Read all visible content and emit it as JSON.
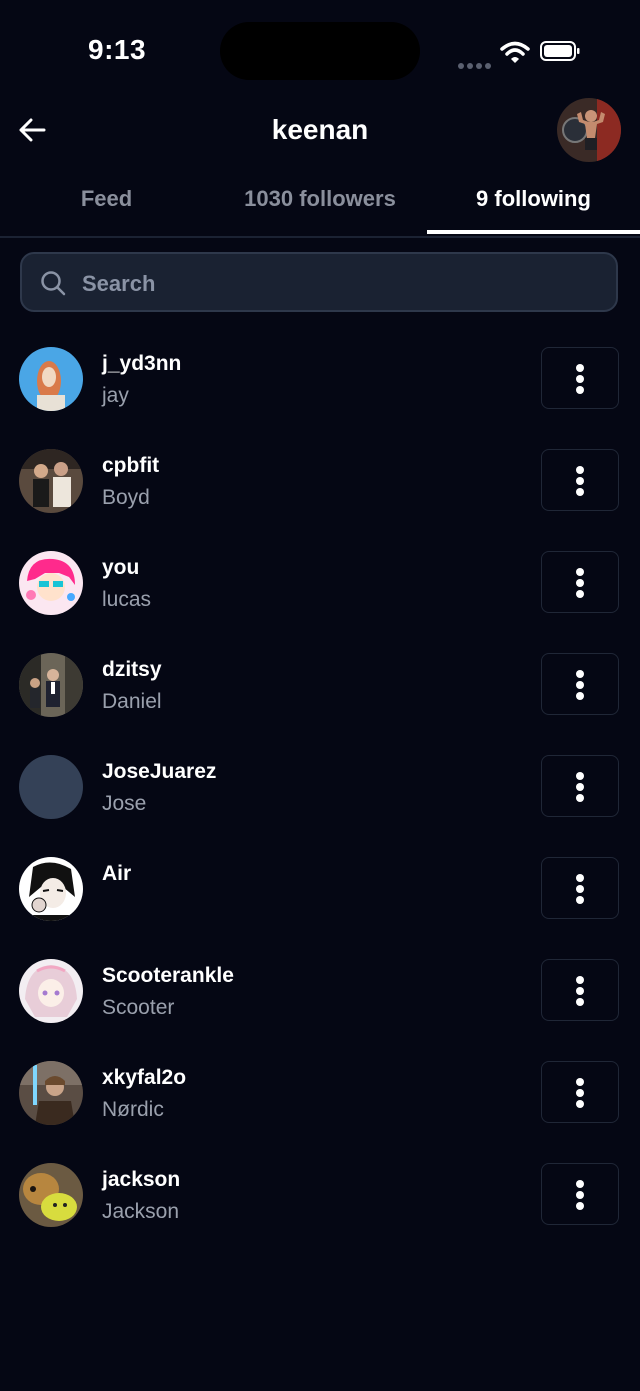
{
  "status": {
    "time": "9:13"
  },
  "header": {
    "title": "keenan"
  },
  "tabs": [
    {
      "label": "Feed"
    },
    {
      "label": "1030 followers"
    },
    {
      "label": "9 following"
    }
  ],
  "active_tab": "9 following",
  "search": {
    "placeholder": "Search",
    "value": ""
  },
  "following": [
    {
      "username": "j_yd3nn",
      "display_name": "jay"
    },
    {
      "username": "cpbfit",
      "display_name": "Boyd"
    },
    {
      "username": "you",
      "display_name": "lucas"
    },
    {
      "username": "dzitsy",
      "display_name": "Daniel"
    },
    {
      "username": "JoseJuarez",
      "display_name": "Jose"
    },
    {
      "username": "Air",
      "display_name": ""
    },
    {
      "username": "Scooterankle",
      "display_name": "Scooter"
    },
    {
      "username": "xkyfal2o",
      "display_name": "Nørdic"
    },
    {
      "username": "jackson",
      "display_name": "Jackson"
    }
  ],
  "colors": {
    "background": "#050714",
    "search_bg": "#1a2232",
    "secondary_text": "#9aa0ad",
    "placeholder_avatar": "#344157"
  },
  "icons": [
    "back-arrow-icon",
    "search-icon",
    "more-vertical-icon",
    "wifi-icon",
    "battery-icon"
  ]
}
